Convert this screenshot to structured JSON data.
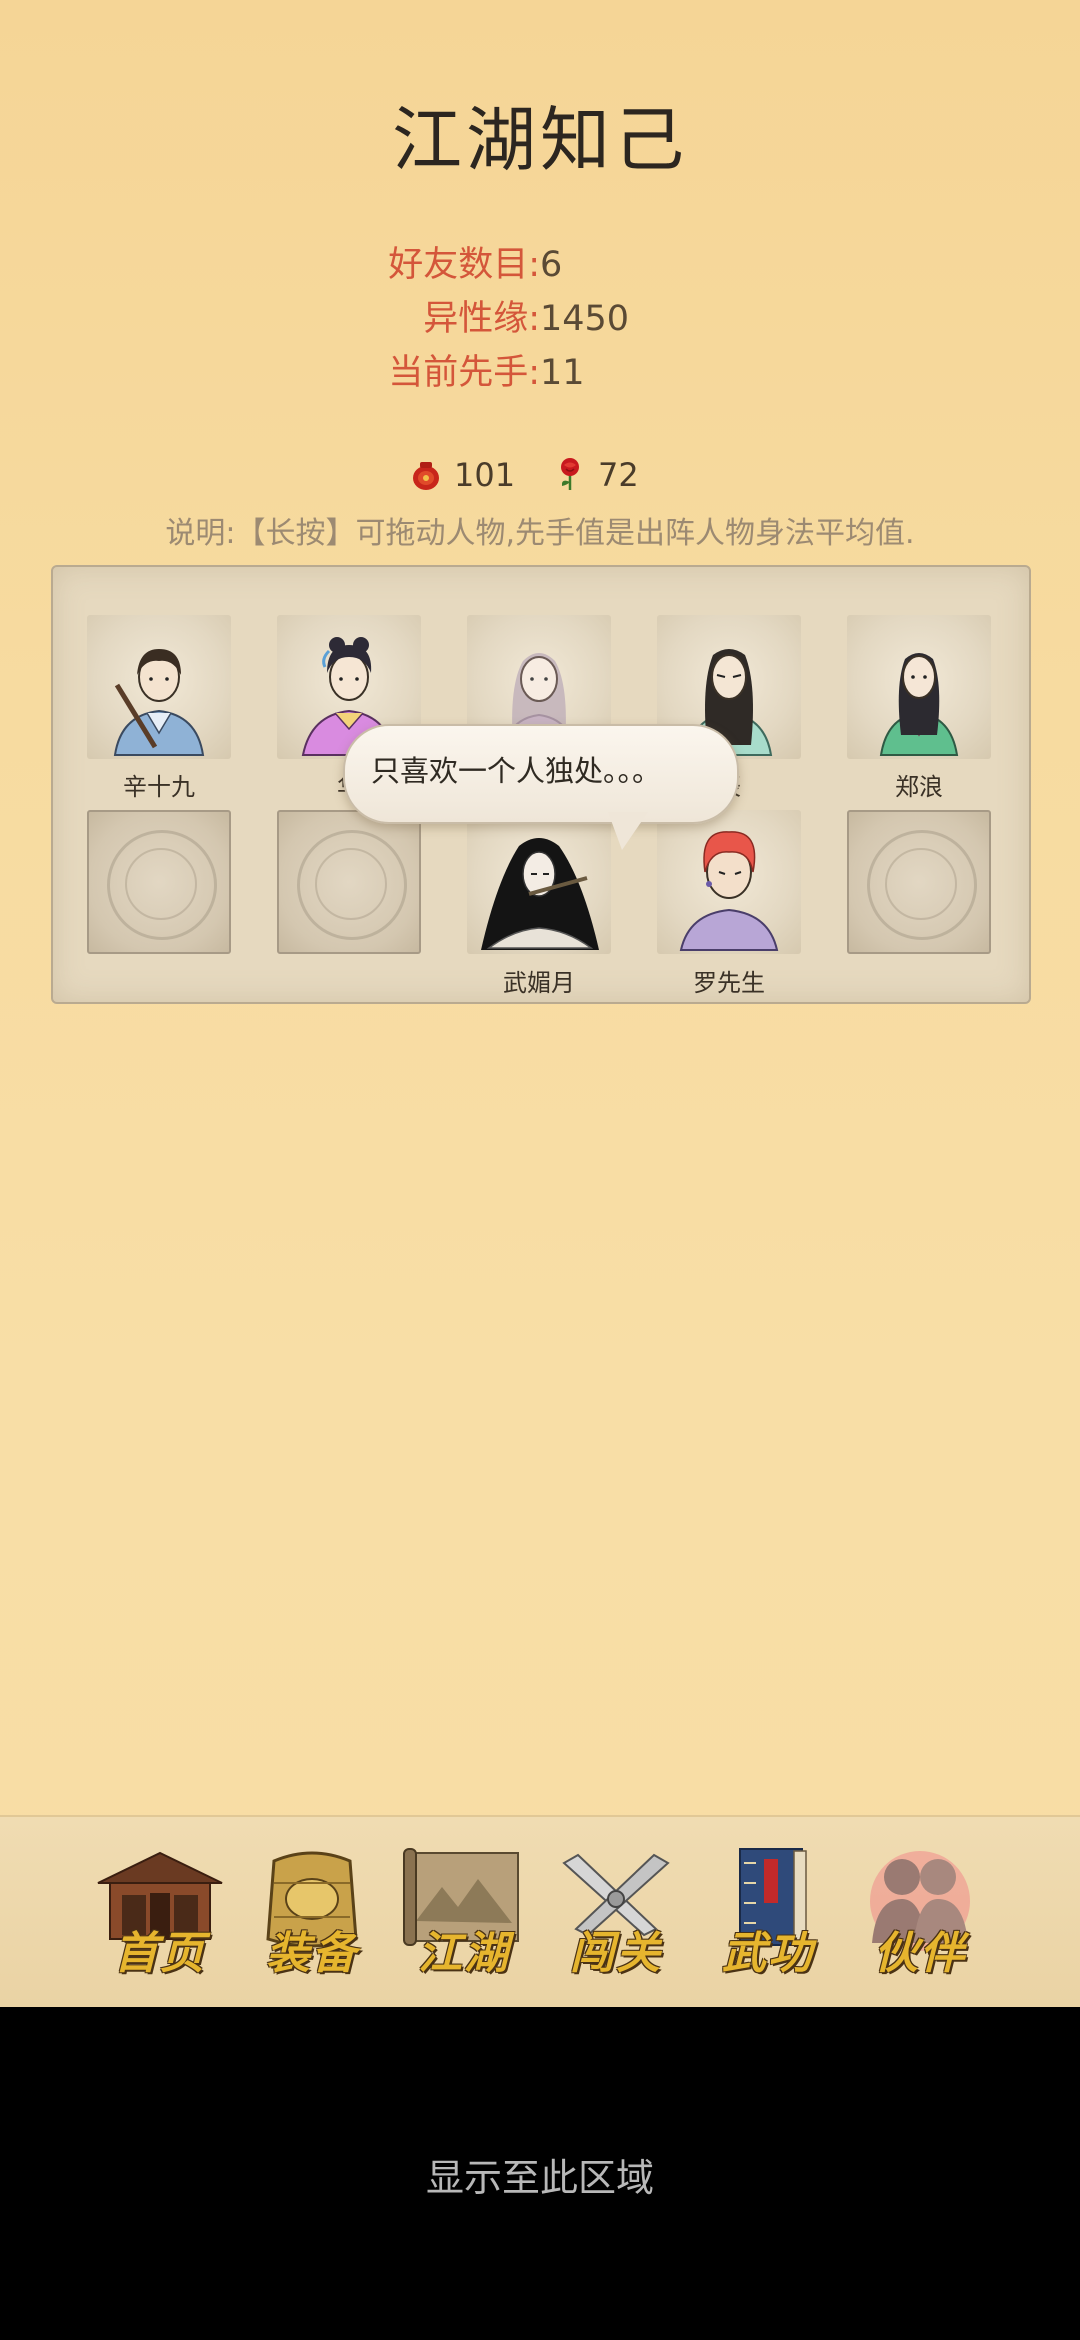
{
  "header": {
    "title": "江湖知己"
  },
  "stats": [
    {
      "label": "好友数目:",
      "value": "6"
    },
    {
      "label": "异性缘:",
      "value": "1450"
    },
    {
      "label": "当前先手:",
      "value": "11"
    }
  ],
  "resources": [
    {
      "icon": "red-pouch-icon",
      "value": "101"
    },
    {
      "icon": "rose-icon",
      "value": "72"
    }
  ],
  "hint": "说明:【长按】可拖动人物,先手值是出阵人物身法平均值.",
  "party": {
    "row1": [
      {
        "name": "辛十九"
      },
      {
        "name": "华"
      },
      {
        "name": ""
      },
      {
        "name": "辰"
      },
      {
        "name": "郑浪"
      }
    ],
    "row2": [
      {
        "name": ""
      },
      {
        "name": ""
      },
      {
        "name": "武媚月"
      },
      {
        "name": "罗先生"
      },
      {
        "name": ""
      }
    ]
  },
  "bubble": {
    "text": "只喜欢一个人独处。。。"
  },
  "tabs": [
    {
      "label": "首页",
      "icon": "temple-icon"
    },
    {
      "label": "装备",
      "icon": "armor-icon"
    },
    {
      "label": "江湖",
      "icon": "scroll-map-icon"
    },
    {
      "label": "闯关",
      "icon": "crossed-swords-icon"
    },
    {
      "label": "武功",
      "icon": "book-icon"
    },
    {
      "label": "伙伴",
      "icon": "companions-icon"
    }
  ],
  "footer": {
    "text": "显示至此区域"
  },
  "colors": {
    "accent_label": "#d4563a",
    "tab_text": "#e6b52e",
    "background": "#f7dba0"
  }
}
